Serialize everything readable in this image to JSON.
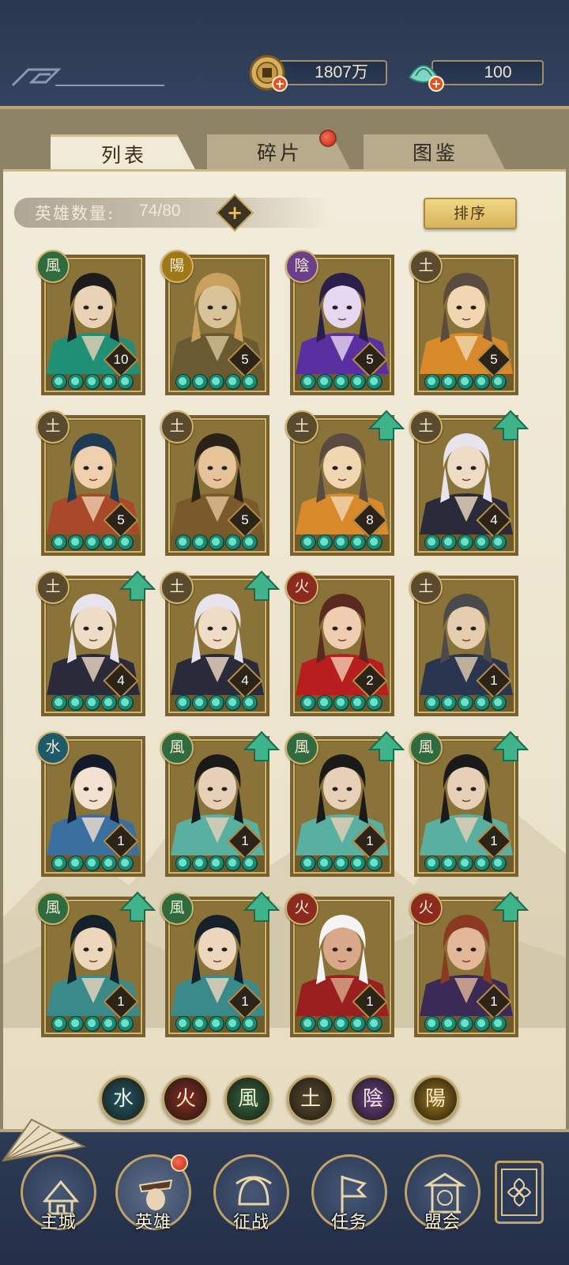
{
  "resources": {
    "coins": {
      "value": "1807万",
      "icon": "coin-icon"
    },
    "jade": {
      "value": "100",
      "icon": "jade-shell-icon"
    }
  },
  "tabs": [
    {
      "label": "列表",
      "active": true
    },
    {
      "label": "碎片",
      "active": false,
      "badge": true
    },
    {
      "label": "图鉴",
      "active": false
    }
  ],
  "hero_count": {
    "label": "英雄数量:",
    "value": "74/80"
  },
  "sort_label": "排序",
  "heroes": [
    {
      "element": "風",
      "element_color": "#2f6b3f",
      "level": "10",
      "upgrade": false,
      "palette": [
        "#1f8f76",
        "#e9d2b6",
        "#1c1c1c"
      ]
    },
    {
      "element": "陽",
      "element_color": "#a07818",
      "level": "5",
      "upgrade": false,
      "palette": [
        "#6a5a32",
        "#d8c39a",
        "#caa060"
      ]
    },
    {
      "element": "陰",
      "element_color": "#6b3f8c",
      "level": "5",
      "upgrade": false,
      "palette": [
        "#5a2fa0",
        "#e6d8f0",
        "#2a1f4a"
      ]
    },
    {
      "element": "土",
      "element_color": "#5a4a2e",
      "level": "5",
      "upgrade": false,
      "palette": [
        "#d88a2a",
        "#f1d6b2",
        "#5a4a40"
      ]
    },
    {
      "element": "土",
      "element_color": "#5a4a2e",
      "level": "5",
      "upgrade": false,
      "palette": [
        "#a84a2a",
        "#efcfae",
        "#1f3a55"
      ]
    },
    {
      "element": "土",
      "element_color": "#5a4a2e",
      "level": "5",
      "upgrade": false,
      "palette": [
        "#7a5a2a",
        "#e6c39a",
        "#2a2218"
      ]
    },
    {
      "element": "土",
      "element_color": "#5a4a2e",
      "level": "8",
      "upgrade": true,
      "palette": [
        "#d88a2a",
        "#f1d6b2",
        "#5a4a40"
      ]
    },
    {
      "element": "土",
      "element_color": "#5a4a2e",
      "level": "4",
      "upgrade": true,
      "palette": [
        "#2a2a3a",
        "#efdcc6",
        "#e8e4ee"
      ]
    },
    {
      "element": "土",
      "element_color": "#5a4a2e",
      "level": "4",
      "upgrade": true,
      "palette": [
        "#2a2a3a",
        "#efdcc6",
        "#e8e4ee"
      ]
    },
    {
      "element": "土",
      "element_color": "#5a4a2e",
      "level": "4",
      "upgrade": true,
      "palette": [
        "#2a2a3a",
        "#efdcc6",
        "#e8e4ee"
      ]
    },
    {
      "element": "火",
      "element_color": "#8c2a1f",
      "level": "2",
      "upgrade": false,
      "palette": [
        "#b81e1e",
        "#f0cdb0",
        "#5a2a20"
      ]
    },
    {
      "element": "土",
      "element_color": "#5a4a2e",
      "level": "1",
      "upgrade": false,
      "palette": [
        "#2a3550",
        "#e6cdb0",
        "#4a4a4a"
      ]
    },
    {
      "element": "水",
      "element_color": "#1f5a6b",
      "level": "1",
      "upgrade": false,
      "palette": [
        "#3a6fa0",
        "#f2e0d0",
        "#141a2a"
      ]
    },
    {
      "element": "風",
      "element_color": "#2f6b3f",
      "level": "1",
      "upgrade": true,
      "palette": [
        "#5ab0a0",
        "#e6d0b8",
        "#1a1a1a"
      ]
    },
    {
      "element": "風",
      "element_color": "#2f6b3f",
      "level": "1",
      "upgrade": true,
      "palette": [
        "#5ab0a0",
        "#e6d0b8",
        "#1a1a1a"
      ]
    },
    {
      "element": "風",
      "element_color": "#2f6b3f",
      "level": "1",
      "upgrade": true,
      "palette": [
        "#5ab0a0",
        "#e6d0b8",
        "#1a1a1a"
      ]
    },
    {
      "element": "風",
      "element_color": "#2f6b3f",
      "level": "1",
      "upgrade": true,
      "palette": [
        "#3a8a8a",
        "#ecd6bc",
        "#14202a"
      ]
    },
    {
      "element": "風",
      "element_color": "#2f6b3f",
      "level": "1",
      "upgrade": true,
      "palette": [
        "#3a8a8a",
        "#ecd6bc",
        "#14202a"
      ]
    },
    {
      "element": "火",
      "element_color": "#8c2a1f",
      "level": "1",
      "upgrade": false,
      "palette": [
        "#9a1f1f",
        "#d9a88a",
        "#f4f4f4"
      ]
    },
    {
      "element": "火",
      "element_color": "#8c2a1f",
      "level": "1",
      "upgrade": true,
      "palette": [
        "#3a2a55",
        "#e2b898",
        "#8a3a20"
      ]
    }
  ],
  "element_filters": [
    {
      "label": "水",
      "color": "#1f5a6b"
    },
    {
      "label": "火",
      "color": "#8c2a1f"
    },
    {
      "label": "風",
      "color": "#2f6b3f"
    },
    {
      "label": "土",
      "color": "#5a4a2e"
    },
    {
      "label": "陰",
      "color": "#6b3f8c"
    },
    {
      "label": "陽",
      "color": "#a07818"
    }
  ],
  "nav": [
    {
      "label": "主城",
      "icon": "castle-icon",
      "active": false
    },
    {
      "label": "英雄",
      "icon": "hero-portrait-icon",
      "active": true,
      "badge": true
    },
    {
      "label": "征战",
      "icon": "battle-helmet-icon",
      "active": false
    },
    {
      "label": "任务",
      "icon": "task-flag-icon",
      "active": false
    },
    {
      "label": "盟会",
      "icon": "guild-pavilion-icon",
      "active": false
    }
  ],
  "menu_icon": "lattice-menu-icon"
}
